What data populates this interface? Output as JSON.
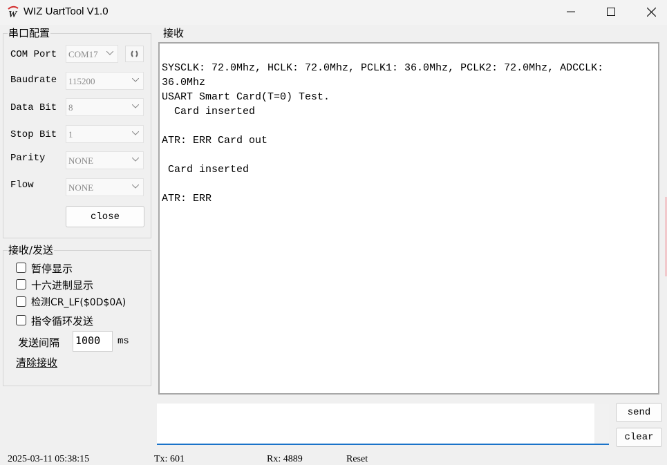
{
  "window": {
    "title": "WIZ UartTool V1.0"
  },
  "config": {
    "group_title": "串口配置",
    "fields": [
      {
        "label": "COM Port",
        "value": "COM17"
      },
      {
        "label": "Baudrate",
        "value": "115200"
      },
      {
        "label": "Data Bit",
        "value": "8"
      },
      {
        "label": "Stop Bit",
        "value": "1"
      },
      {
        "label": "Parity",
        "value": "NONE"
      },
      {
        "label": "Flow",
        "value": "NONE"
      }
    ],
    "close_label": "close"
  },
  "transfer": {
    "group_title": "接收/发送",
    "checkboxes": [
      {
        "label": "暂停显示",
        "checked": false
      },
      {
        "label": "十六进制显示",
        "checked": false
      },
      {
        "label": "检测CR_LF($0D$0A)",
        "checked": false
      },
      {
        "label": "指令循环发送",
        "checked": false
      }
    ],
    "interval_label": "发送间隔",
    "interval_value": "1000",
    "interval_unit": "ms",
    "clear_receive_label": "清除接收"
  },
  "receive": {
    "group_title": "接收",
    "lines": [
      "SYSCLK: 72.0Mhz, HCLK: 72.0Mhz, PCLK1: 36.0Mhz, PCLK2: 72.0Mhz, ADCCLK:",
      "36.0Mhz",
      "USART Smart Card(T=0) Test.",
      "  Card inserted",
      "",
      "ATR: ERR Card out",
      "",
      " Card inserted",
      "",
      "ATR: ERR"
    ]
  },
  "send": {
    "value": "",
    "send_label": "send",
    "clear_label": "clear"
  },
  "statusbar": {
    "datetime": "2025-03-11 05:38:15",
    "tx": "Tx: 601",
    "rx": "Rx: 4889",
    "reset": "Reset"
  },
  "icons": {
    "logo": "wiz-logo-icon",
    "refresh": "refresh-icon",
    "dropdown": "chevron-down-icon"
  }
}
